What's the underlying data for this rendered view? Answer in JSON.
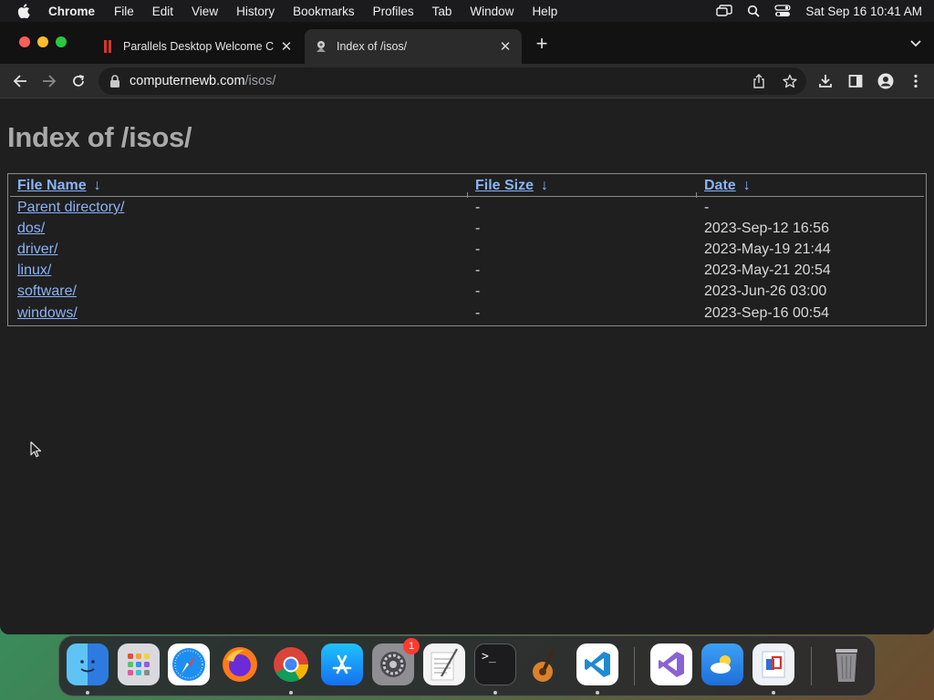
{
  "menubar": {
    "app_name": "Chrome",
    "items": [
      "File",
      "Edit",
      "View",
      "History",
      "Bookmarks",
      "Profiles",
      "Tab",
      "Window",
      "Help"
    ],
    "clock": "Sat Sep 16  10:41 AM"
  },
  "tabs": [
    {
      "title": "Parallels Desktop Welcome Ce",
      "active": false
    },
    {
      "title": "Index of /isos/",
      "active": true
    }
  ],
  "omnibox": {
    "host": "computernewb.com",
    "path": "/isos/"
  },
  "page": {
    "heading": "Index of /isos/",
    "columns": {
      "name": "File Name",
      "size": "File Size",
      "date": "Date",
      "sort_glyph": "↓"
    },
    "rows": [
      {
        "name": "Parent directory/",
        "size": "-",
        "date": "-"
      },
      {
        "name": "dos/",
        "size": "-",
        "date": "2023-Sep-12 16:56"
      },
      {
        "name": "driver/",
        "size": "-",
        "date": "2023-May-19 21:44"
      },
      {
        "name": "linux/",
        "size": "-",
        "date": "2023-May-21 20:54"
      },
      {
        "name": "software/",
        "size": "-",
        "date": "2023-Jun-26 03:00"
      },
      {
        "name": "windows/",
        "size": "-",
        "date": "2023-Sep-16 00:54"
      }
    ]
  },
  "dock": {
    "apps": [
      "finder-icon",
      "launchpad-icon",
      "safari-icon",
      "firefox-icon",
      "chrome-icon",
      "app-store-icon",
      "system-settings-icon",
      "textedit-icon",
      "terminal-icon",
      "garageband-icon",
      "vscode-icon",
      "visual-studio-icon",
      "weather-icon",
      "parallels-icon",
      "trash-icon"
    ],
    "settings_badge": "1"
  },
  "colors": {
    "link": "#8ab4f8",
    "page_bg": "#1f1f1f",
    "heading": "#a9a9a9"
  }
}
